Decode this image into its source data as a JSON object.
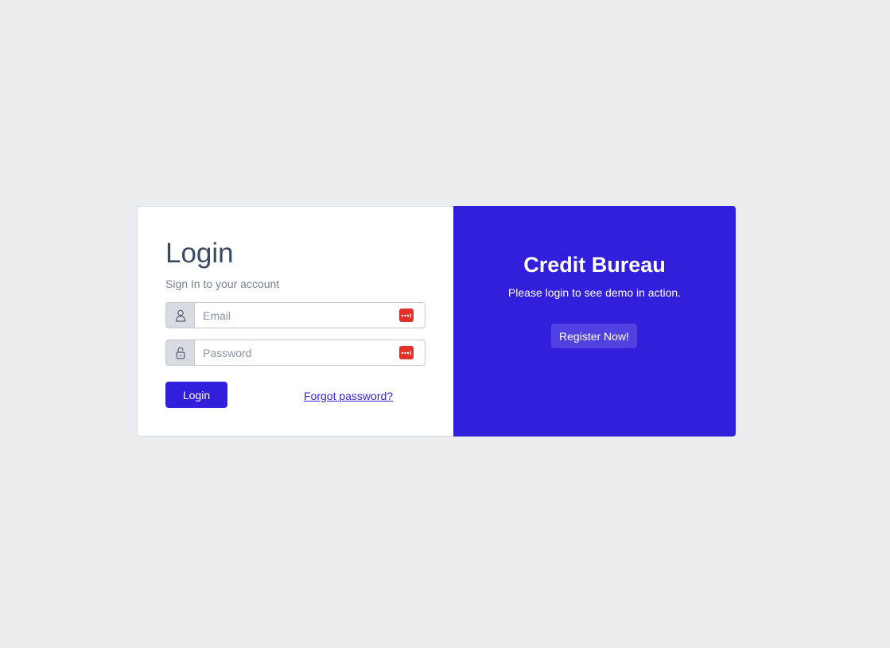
{
  "login": {
    "title": "Login",
    "subtitle": "Sign In to your account",
    "email_placeholder": "Email",
    "password_placeholder": "Password",
    "login_button": "Login",
    "forgot_link": "Forgot password?"
  },
  "promo": {
    "title": "Credit Bureau",
    "text": "Please login to see demo in action.",
    "register_button": "Register Now!"
  },
  "icons": {
    "email_prepend": "user-icon",
    "password_prepend": "lock-icon",
    "password_manager": "password-manager-icon"
  },
  "colors": {
    "primary": "#321fdb",
    "background": "#ebedef",
    "heading": "#3c4b64",
    "muted": "#768192",
    "password_manager": "#e0322b"
  }
}
